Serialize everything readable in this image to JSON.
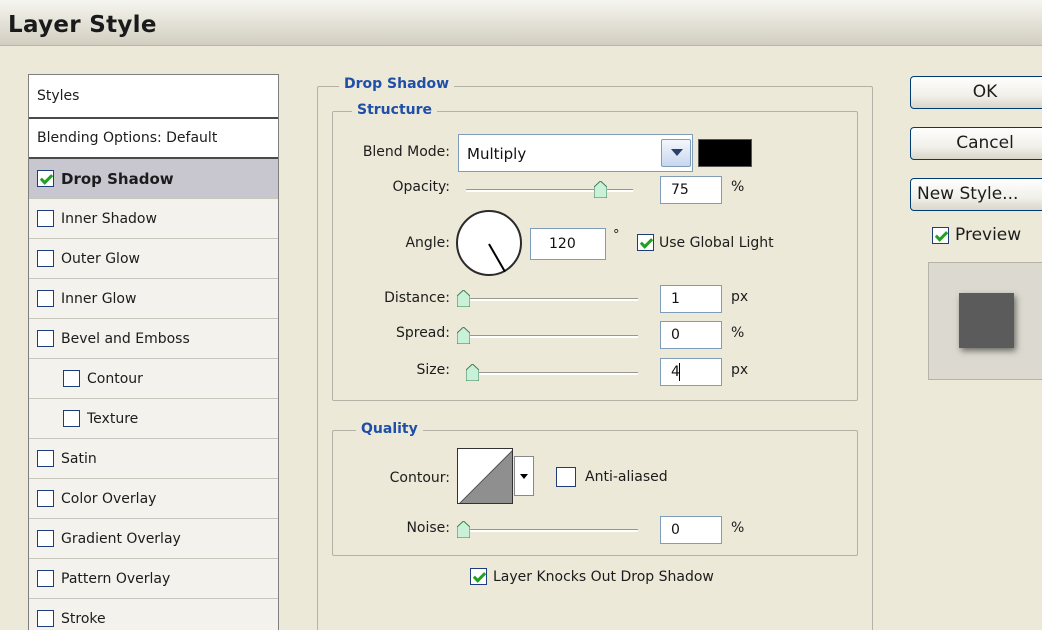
{
  "window": {
    "title": "Layer Style"
  },
  "styles_panel": {
    "header": "Styles",
    "blending_options": "Blending Options: Default",
    "items": [
      {
        "label": "Drop Shadow",
        "checked": true,
        "selected": true,
        "indent": false
      },
      {
        "label": "Inner Shadow",
        "checked": false,
        "selected": false,
        "indent": false
      },
      {
        "label": "Outer Glow",
        "checked": false,
        "selected": false,
        "indent": false
      },
      {
        "label": "Inner Glow",
        "checked": false,
        "selected": false,
        "indent": false
      },
      {
        "label": "Bevel and Emboss",
        "checked": false,
        "selected": false,
        "indent": false
      },
      {
        "label": "Contour",
        "checked": false,
        "selected": false,
        "indent": true
      },
      {
        "label": "Texture",
        "checked": false,
        "selected": false,
        "indent": true
      },
      {
        "label": "Satin",
        "checked": false,
        "selected": false,
        "indent": false
      },
      {
        "label": "Color Overlay",
        "checked": false,
        "selected": false,
        "indent": false
      },
      {
        "label": "Gradient Overlay",
        "checked": false,
        "selected": false,
        "indent": false
      },
      {
        "label": "Pattern Overlay",
        "checked": false,
        "selected": false,
        "indent": false
      },
      {
        "label": "Stroke",
        "checked": false,
        "selected": false,
        "indent": false
      }
    ]
  },
  "drop_shadow": {
    "title": "Drop Shadow",
    "structure": {
      "title": "Structure",
      "blend_mode": {
        "label": "Blend Mode:",
        "value": "Multiply",
        "color": "#000000"
      },
      "opacity": {
        "label": "Opacity:",
        "value": "75",
        "unit": "%",
        "slider_fraction": 0.75
      },
      "angle": {
        "label": "Angle:",
        "value": "120",
        "unit": "°",
        "degrees": 120,
        "use_global_light_label": "Use Global Light",
        "use_global_light": true
      },
      "distance": {
        "label": "Distance:",
        "value": "1",
        "unit": "px"
      },
      "spread": {
        "label": "Spread:",
        "value": "0",
        "unit": "%"
      },
      "size": {
        "label": "Size:",
        "value": "4",
        "unit": "px"
      }
    },
    "quality": {
      "title": "Quality",
      "contour": {
        "label": "Contour:",
        "anti_aliased_label": "Anti-aliased",
        "anti_aliased": false
      },
      "noise": {
        "label": "Noise:",
        "value": "0",
        "unit": "%"
      }
    },
    "knockout": {
      "label": "Layer Knocks Out Drop Shadow",
      "checked": true
    }
  },
  "buttons": {
    "ok": "OK",
    "cancel": "Cancel",
    "new_style": "New Style...",
    "preview_label": "Preview",
    "preview_checked": true
  },
  "colors": {
    "accent_title": "#1f4fa8",
    "check": "#21a121",
    "selected_row": "#c8c7cf",
    "dialog_bg": "#ece9d8"
  }
}
